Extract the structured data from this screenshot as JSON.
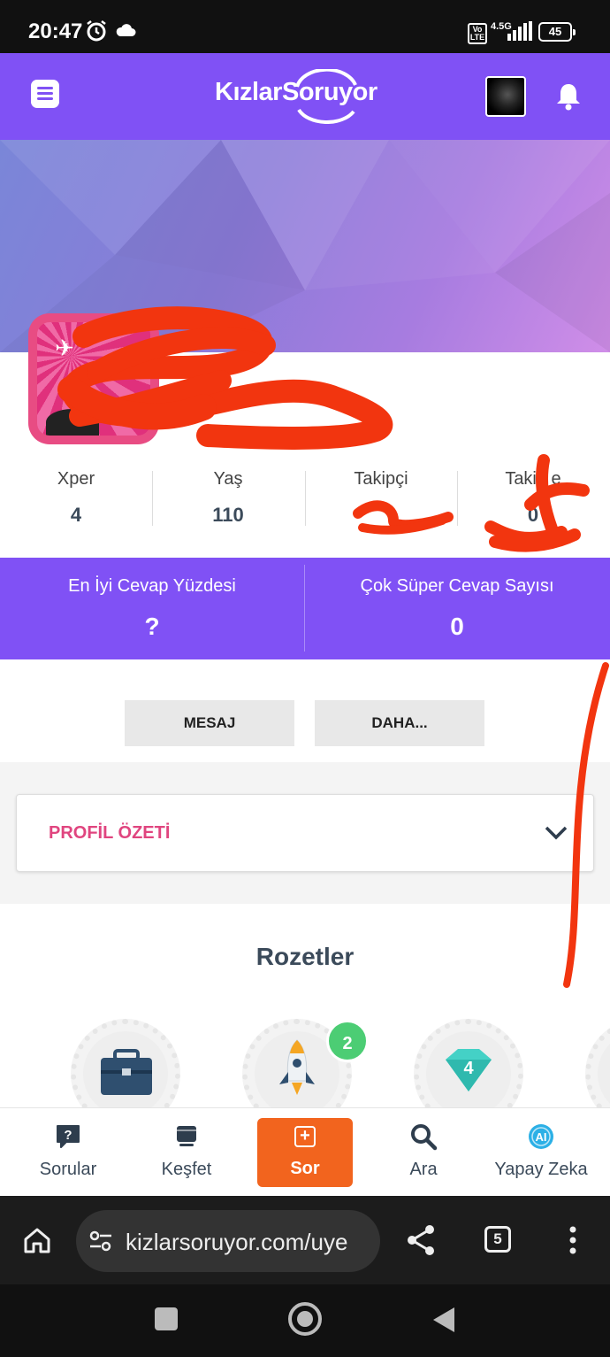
{
  "status_bar": {
    "time": "20:47",
    "network": "4.5G",
    "volte": "Vo LTE",
    "battery": "45"
  },
  "header": {
    "logo": "KızlarSoruyor",
    "icons": [
      "menu-icon",
      "bell-icon"
    ]
  },
  "profile": {
    "stats": [
      {
        "label": "Xper",
        "value": "4"
      },
      {
        "label": "Yaş",
        "value": "110"
      },
      {
        "label": "Takipçi",
        "value": ""
      },
      {
        "label": "Takip e",
        "value": "0"
      }
    ],
    "highlights": [
      {
        "label": "En İyi Cevap Yüzdesi",
        "value": "?"
      },
      {
        "label": "Çok Süper Cevap Sayısı",
        "value": "0"
      }
    ],
    "actions": {
      "message": "MESAJ",
      "more": "DAHA..."
    },
    "summary_title": "PROFİL ÖZETİ"
  },
  "badges": {
    "heading": "Rozetler",
    "items": [
      {
        "icon": "briefcase-icon"
      },
      {
        "icon": "rocket-icon",
        "count": "2"
      },
      {
        "icon": "diamond-icon",
        "level": "4"
      }
    ]
  },
  "bottom_nav": [
    {
      "label": "Sorular",
      "icon": "question-icon"
    },
    {
      "label": "Keşfet",
      "icon": "layers-icon"
    },
    {
      "label": "Sor",
      "icon": "plus-icon"
    },
    {
      "label": "Ara",
      "icon": "search-icon"
    },
    {
      "label": "Yapay Zeka",
      "icon": "ai-icon"
    }
  ],
  "browser": {
    "url": "kizlarsoruyor.com/uye",
    "tab_count": "5"
  },
  "colors": {
    "brand_purple": "#8051f5",
    "accent_orange": "#f2641e",
    "summary_pink": "#e0457f",
    "badge_green": "#4ccd74"
  }
}
